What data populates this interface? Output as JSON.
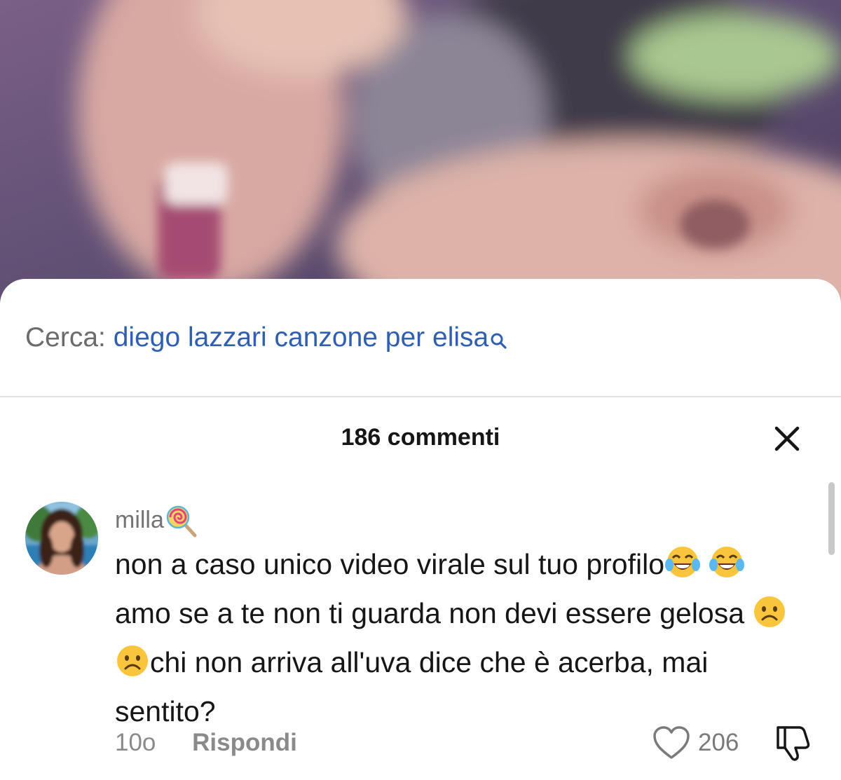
{
  "search": {
    "prefix": "Cerca:",
    "query": "diego lazzari canzone per elisa"
  },
  "comments_panel": {
    "title": "186 commenti"
  },
  "comment": {
    "username": "milla",
    "text_parts": [
      "non a caso unico video virale sul tuo profilo",
      "amo se a te non ti guarda non devi essere gelosa",
      "chi non arriva all'uva dice che è acerba, mai sentito?"
    ],
    "age": "10o",
    "reply_label": "Rispondi",
    "like_count": "206"
  },
  "colors": {
    "link_blue": "#2f5fb3",
    "text_dark": "#161616",
    "text_muted": "#8a8a8a"
  },
  "icons": [
    "search-icon",
    "close-icon",
    "lollipop-icon",
    "tears-of-joy-emoji",
    "frowning-face-emoji",
    "heart-icon",
    "thumbs-down-icon"
  ]
}
